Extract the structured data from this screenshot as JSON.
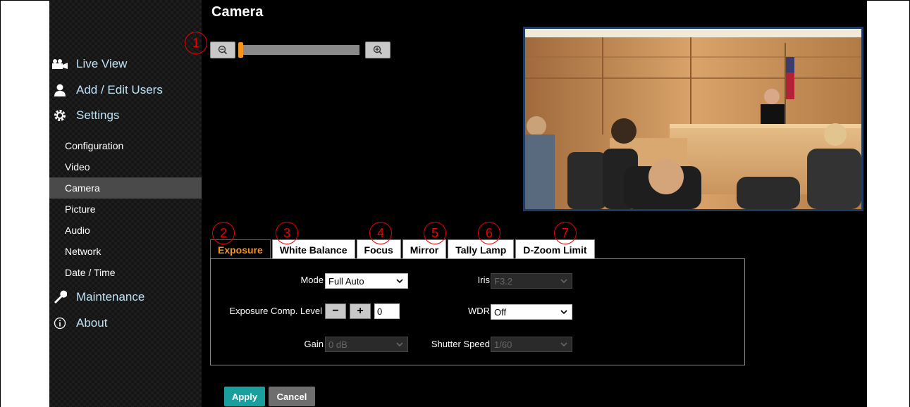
{
  "page": {
    "title": "Camera"
  },
  "sidebar": {
    "main": [
      {
        "label": "Live View",
        "icon": "video-camera-icon"
      },
      {
        "label": "Add / Edit Users",
        "icon": "user-icon"
      },
      {
        "label": "Settings",
        "icon": "gear-icon"
      }
    ],
    "sub": [
      {
        "label": "Configuration"
      },
      {
        "label": "Video"
      },
      {
        "label": "Camera",
        "active": true
      },
      {
        "label": "Picture"
      },
      {
        "label": "Audio"
      },
      {
        "label": "Network"
      },
      {
        "label": "Date / Time"
      }
    ],
    "bottom": [
      {
        "label": "Maintenance",
        "icon": "wrench-icon"
      },
      {
        "label": "About",
        "icon": "info-icon"
      }
    ]
  },
  "zoom": {
    "level": 0,
    "zoom_out_icon": "zoom-out-icon",
    "zoom_in_icon": "zoom-in-icon"
  },
  "callouts": [
    "1",
    "2",
    "3",
    "4",
    "5",
    "6",
    "7"
  ],
  "tabs": [
    {
      "label": "Exposure",
      "active": true
    },
    {
      "label": "White Balance"
    },
    {
      "label": "Focus"
    },
    {
      "label": "Mirror"
    },
    {
      "label": "Tally Lamp"
    },
    {
      "label": "D-Zoom Limit"
    }
  ],
  "exposure": {
    "mode_label": "Mode",
    "mode_value": "Full Auto",
    "iris_label": "Iris",
    "iris_value": "F3.2",
    "comp_label": "Exposure Comp. Level",
    "comp_minus": "−",
    "comp_plus": "+",
    "comp_value": "0",
    "wdr_label": "WDR",
    "wdr_value": "Off",
    "gain_label": "Gain",
    "gain_value": "0 dB",
    "shutter_label": "Shutter Speed",
    "shutter_value": "1/60"
  },
  "actions": {
    "apply": "Apply",
    "cancel": "Cancel"
  },
  "colors": {
    "accent": "#f7941d",
    "apply": "#1a9e9e",
    "callout": "#e00000",
    "nav_text": "#bfe3f5"
  }
}
